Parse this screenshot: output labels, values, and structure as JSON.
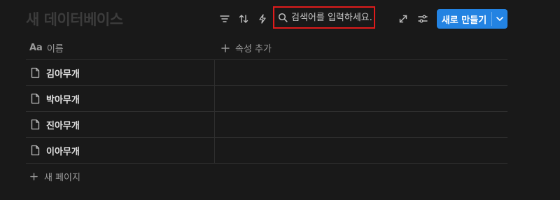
{
  "database": {
    "title": "새 데이터베이스"
  },
  "toolbar": {
    "filter_icon": "filter-icon",
    "sort_icon": "sort-icon",
    "automation_icon": "lightning-icon",
    "search": {
      "placeholder": "검색어를 입력하세요.",
      "value": ""
    },
    "expand_icon": "expand-icon",
    "settings_icon": "settings-sliders-icon",
    "new_button": {
      "label": "새로 만들기",
      "accent": "#2383e2"
    }
  },
  "table": {
    "columns": [
      {
        "label": "이름",
        "type_icon": "Aa"
      }
    ],
    "add_property_label": "속성 추가",
    "rows": [
      {
        "title": "김아무개"
      },
      {
        "title": "박아무개"
      },
      {
        "title": "진아무개"
      },
      {
        "title": "이아무개"
      }
    ],
    "new_page_label": "새 페이지"
  },
  "colors": {
    "background": "#191919",
    "highlight_border": "#e01b1b",
    "accent": "#2383e2"
  }
}
